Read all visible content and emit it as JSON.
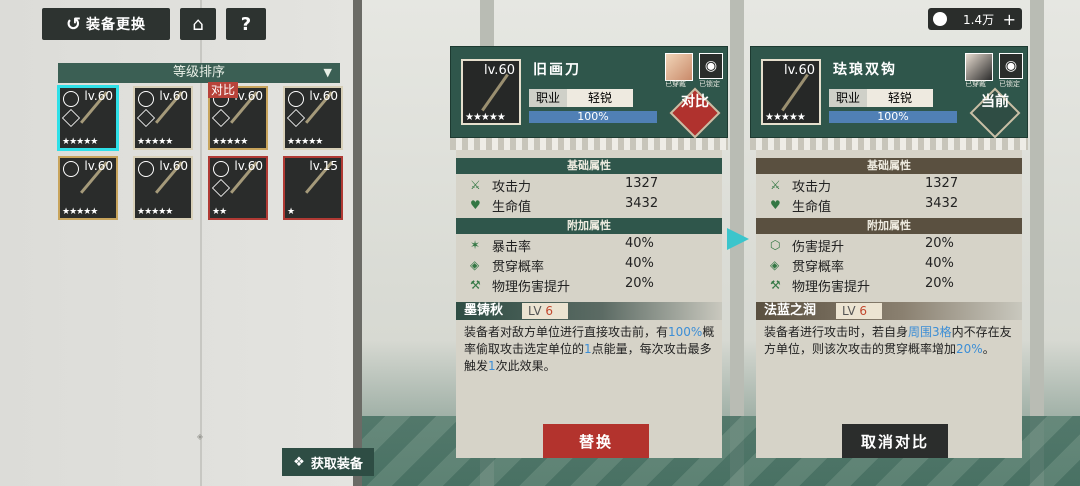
{
  "topbar": {
    "back_label": "装备更换",
    "home_icon": "home-icon",
    "help_label": "?",
    "currency_value": "1.4万",
    "currency_plus": "+"
  },
  "sort": {
    "label": "等级排序"
  },
  "inventory": {
    "items": [
      {
        "level": "lv.60",
        "stars": "★★★★★",
        "frame": "sel"
      },
      {
        "level": "lv.60",
        "stars": "★★★★★",
        "frame": "normal"
      },
      {
        "level": "lv.60",
        "stars": "★★★★★",
        "frame": "gold",
        "tag": "对比"
      },
      {
        "level": "lv.60",
        "stars": "★★★★★",
        "frame": "normal"
      },
      {
        "level": "lv.60",
        "stars": "★★★★★",
        "frame": "gold"
      },
      {
        "level": "lv.60",
        "stars": "★★★★★",
        "frame": "normal"
      },
      {
        "level": "lv.60",
        "stars": "★★",
        "frame": "red"
      },
      {
        "level": "lv.15",
        "stars": "★",
        "frame": "red"
      }
    ],
    "obtain_label": "获取装备"
  },
  "left_equipment": {
    "level": "lv.60",
    "stars": "★★★★★",
    "name": "旧画刀",
    "job_key": "职业",
    "job_value": "轻锐",
    "progress": "100%",
    "worn_label": "已穿戴",
    "locked_label": "已锁定",
    "compare_label": "对比",
    "base_title": "基础属性",
    "base": [
      {
        "icon": "crossed-swords-icon",
        "name": "攻击力",
        "value": "1327"
      },
      {
        "icon": "heart-icon",
        "name": "生命值",
        "value": "3432"
      }
    ],
    "extra_title": "附加属性",
    "extra": [
      {
        "icon": "crit-icon",
        "name": "暴击率",
        "value": "40%"
      },
      {
        "icon": "pierce-icon",
        "name": "贯穿概率",
        "value": "40%"
      },
      {
        "icon": "physical-damage-icon",
        "name": "物理伤害提升",
        "value": "20%"
      }
    ],
    "skill_name": "墨铸秋",
    "skill_lv_prefix": "LV ",
    "skill_lv": "6",
    "skill_desc": [
      "装备者对敌方单位进行直接攻击前，有",
      "100%",
      "概率偷取攻击选定单位的",
      "1",
      "点能量，每次攻击最多触发",
      "1",
      "次此效果。"
    ],
    "button": "替换"
  },
  "right_equipment": {
    "level": "lv.60",
    "stars": "★★★★★",
    "name": "珐琅双钩",
    "job_key": "职业",
    "job_value": "轻锐",
    "progress": "100%",
    "worn_label": "已穿戴",
    "locked_label": "已锁定",
    "current_label": "当前",
    "base_title": "基础属性",
    "base": [
      {
        "icon": "crossed-swords-icon",
        "name": "攻击力",
        "value": "1327"
      },
      {
        "icon": "heart-icon",
        "name": "生命值",
        "value": "3432"
      }
    ],
    "extra_title": "附加属性",
    "extra": [
      {
        "icon": "damage-up-icon",
        "name": "伤害提升",
        "value": "20%"
      },
      {
        "icon": "pierce-icon",
        "name": "贯穿概率",
        "value": "40%"
      },
      {
        "icon": "physical-damage-icon",
        "name": "物理伤害提升",
        "value": "20%"
      }
    ],
    "skill_name": "法蓝之润",
    "skill_lv_prefix": "LV ",
    "skill_lv": "6",
    "skill_desc": [
      "装备者进行攻击时，若自身",
      "周围3格",
      "内不存在友方单位，则该次攻击的贯穿概率增加",
      "20%",
      "。"
    ],
    "button": "取消对比"
  }
}
